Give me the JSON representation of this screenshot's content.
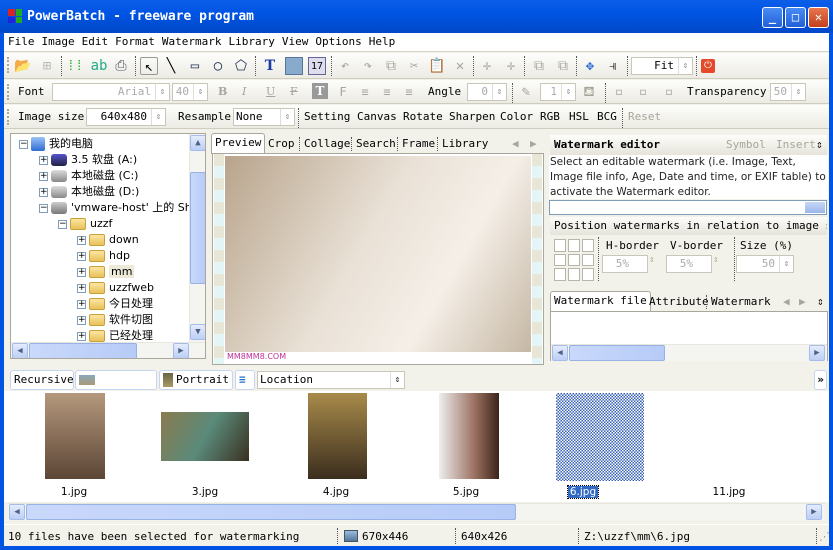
{
  "window": {
    "title": "PowerBatch - freeware program",
    "controls": {
      "minimize": "_",
      "maximize": "□",
      "close": "✕"
    }
  },
  "menu": [
    "File",
    "Image",
    "Edit",
    "Format",
    "Watermark",
    "Library",
    "View",
    "Options",
    "Help"
  ],
  "toolbar": {
    "icons": [
      "open-folder-icon",
      "save-icon",
      "batch-icon",
      "rename-icon",
      "print-icon",
      "select-arrow-icon",
      "line-icon",
      "rectangle-icon",
      "ellipse-icon",
      "polygon-icon",
      "text-icon",
      "image-icon",
      "calendar-icon",
      "undo-icon",
      "redo-icon",
      "copy-icon",
      "cut-icon",
      "paste-icon",
      "delete-icon",
      "bring-forward-icon",
      "send-backward-icon",
      "group-icon",
      "ungroup-icon",
      "move-icon",
      "align-icon",
      "stop-icon"
    ],
    "zoom_value": "Fit"
  },
  "format_bar": {
    "font_label": "Font",
    "font_value": "Arial",
    "size_value": "40",
    "bold": "B",
    "italic": "I",
    "underline": "U",
    "strike": "F",
    "angle_label": "Angle",
    "angle_value": "0",
    "stroke_value": "1",
    "transparency_label": "Transparency",
    "transparency_value": "50"
  },
  "image_bar": {
    "size_label": "Image size",
    "size_value": "640x480",
    "resample_label": "Resample",
    "resample_value": "None",
    "actions": [
      "Setting",
      "Canvas",
      "Rotate",
      "Sharpen",
      "Color",
      "RGB",
      "HSL",
      "BCG"
    ],
    "reset": "Reset"
  },
  "tree": {
    "items": [
      {
        "label": "我的电脑",
        "level": 0,
        "expanded": true,
        "icon": "computer-icon"
      },
      {
        "label": "3.5 软盘 (A:)",
        "level": 1,
        "icon": "floppy-icon"
      },
      {
        "label": "本地磁盘 (C:)",
        "level": 1,
        "icon": "drive-icon"
      },
      {
        "label": "本地磁盘 (D:)",
        "level": 1,
        "icon": "drive-icon"
      },
      {
        "label": "'vmware-host' 上的 Shar",
        "level": 1,
        "expanded": true,
        "icon": "network-drive-icon"
      },
      {
        "label": "uzzf",
        "level": 2,
        "expanded": true,
        "icon": "folder-icon"
      },
      {
        "label": "down",
        "level": 3,
        "icon": "folder-icon"
      },
      {
        "label": "hdp",
        "level": 3,
        "icon": "folder-icon"
      },
      {
        "label": "mm",
        "level": 3,
        "icon": "folder-icon",
        "selected": true
      },
      {
        "label": "uzzfweb",
        "level": 3,
        "icon": "folder-icon"
      },
      {
        "label": "今日处理",
        "level": 3,
        "icon": "folder-icon"
      },
      {
        "label": "软件切图",
        "level": 3,
        "icon": "folder-icon"
      },
      {
        "label": "已经处理",
        "level": 3,
        "icon": "folder-icon"
      }
    ]
  },
  "center_tabs": [
    "Preview",
    "Crop",
    "Collage",
    "Search",
    "Frame",
    "Library"
  ],
  "preview": {
    "caption": "MM8MM8.COM"
  },
  "watermark_editor": {
    "title": "Watermark editor",
    "symbol": "Symbol",
    "insert": "Insert",
    "description": "Select an editable watermark (i.e. Image, Text, Image file info, Age, Date and time, or EXIF table) to activate the Watermark editor.",
    "position_title": "Position watermarks in relation to image size",
    "h_border_label": "H-border",
    "v_border_label": "V-border",
    "size_label": "Size (%)",
    "h_border_value": "5%",
    "v_border_value": "5%",
    "size_value": "50",
    "tabs": [
      "Watermark file",
      "Attribute",
      "Watermark"
    ]
  },
  "filter_bar": {
    "recursive": "Recursive",
    "landscape": "Landscape",
    "portrait": "Portrait",
    "sort_value": "Location",
    "more": "»"
  },
  "thumbnails": [
    {
      "name": "1.jpg",
      "orientation": "portrait"
    },
    {
      "name": "3.jpg",
      "orientation": "landscape"
    },
    {
      "name": "4.jpg",
      "orientation": "portrait"
    },
    {
      "name": "5.jpg",
      "orientation": "portrait"
    },
    {
      "name": "6.jpg",
      "orientation": "portrait",
      "selected": true
    },
    {
      "name": "11.jpg",
      "orientation": "none"
    }
  ],
  "status": {
    "message": "10 files have been selected for watermarking",
    "dims1": "670x446",
    "dims2": "640x426",
    "path": "Z:\\uzzf\\mm\\6.jpg"
  },
  "colors": {
    "titlebar": "#0054e3",
    "face": "#f3f2ea",
    "selection": "#316ac5"
  }
}
